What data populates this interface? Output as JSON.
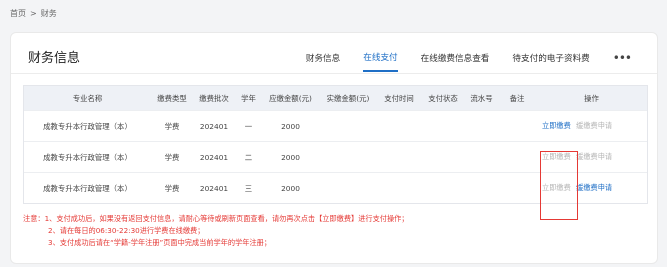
{
  "breadcrumb": {
    "home": "首页",
    "sep": ">",
    "current": "财务"
  },
  "card_title": "财务信息",
  "tabs": [
    {
      "label": "财务信息",
      "active": false
    },
    {
      "label": "在线支付",
      "active": true
    },
    {
      "label": "在线缴费信息查看",
      "active": false
    },
    {
      "label": "待支付的电子资料费",
      "active": false
    }
  ],
  "more_label": "•••",
  "table": {
    "headers": [
      "专业名称",
      "缴费类型",
      "缴费批次",
      "学年",
      "应缴金额(元)",
      "实缴金额(元)",
      "支付时间",
      "支付状态",
      "流水号",
      "备注",
      "操作"
    ],
    "rows": [
      {
        "major": "成教专升本行政管理（本）",
        "type": "学费",
        "batch": "202401",
        "year": "一",
        "due": "2000",
        "paid": "",
        "time": "",
        "status": "",
        "serial": "",
        "note": "",
        "pay": "立即缴费",
        "pay_enabled": true,
        "apply": "缓缴费申请",
        "apply_enabled": false
      },
      {
        "major": "成教专升本行政管理（本）",
        "type": "学费",
        "batch": "202401",
        "year": "二",
        "due": "2000",
        "paid": "",
        "time": "",
        "status": "",
        "serial": "",
        "note": "",
        "pay": "立即缴费",
        "pay_enabled": false,
        "apply": "缓缴费申请",
        "apply_enabled": false
      },
      {
        "major": "成教专升本行政管理（本）",
        "type": "学费",
        "batch": "202401",
        "year": "三",
        "due": "2000",
        "paid": "",
        "time": "",
        "status": "",
        "serial": "",
        "note": "",
        "pay": "立即缴费",
        "pay_enabled": false,
        "apply": "缓缴费申请",
        "apply_enabled": true
      }
    ]
  },
  "notes": [
    "注意：1、支付成功后，如果没有返回支付信息，请耐心等待或刷新页面查看，请勿再次点击【立即缴费】进行支付操作；",
    "2、请在每日的06:30-22:30进行学费在线缴费；",
    "3、支付成功后请在“学籍-学年注册”页面中完成当前学年的学年注册；"
  ],
  "colors": {
    "accent": "#1f6fc6",
    "warning": "#e53935",
    "disabled": "#b5b5b5"
  }
}
